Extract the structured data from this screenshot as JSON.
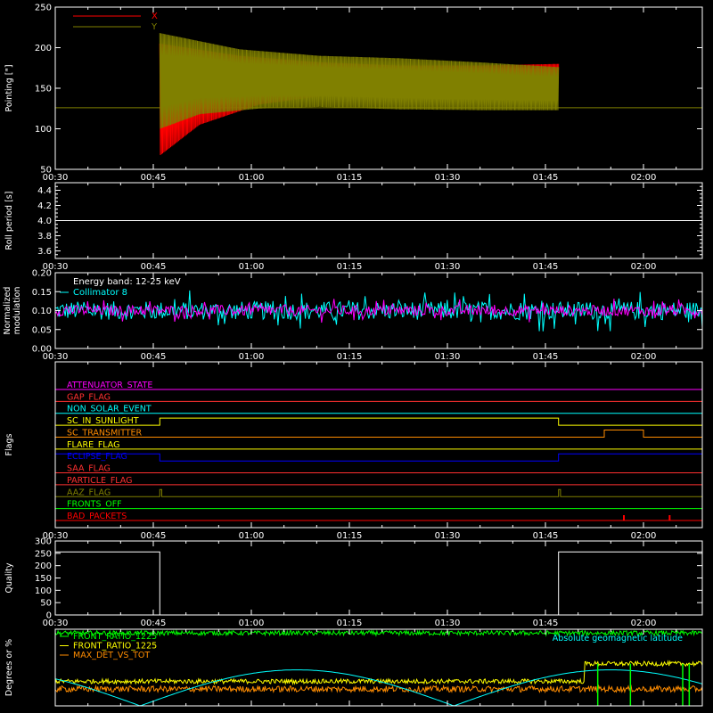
{
  "chart_data": {
    "type": "line",
    "time_ticks": [
      "00:30",
      "00:45",
      "01:00",
      "01:15",
      "01:30",
      "01:45",
      "02:00"
    ],
    "time_range": [
      "00:30",
      "02:09"
    ],
    "data_window": [
      "00:46",
      "01:47"
    ],
    "panels": [
      {
        "id": "pointing",
        "ylabel": "Pointing [\"]",
        "ylim": [
          50,
          250
        ],
        "yticks": [
          "50",
          "100",
          "150",
          "200",
          "250"
        ],
        "xticklabels": true,
        "legend": [
          {
            "name": "X",
            "color": "#ff0000"
          },
          {
            "name": "Y",
            "color": "#808000"
          }
        ],
        "baseline": 126,
        "series": [
          {
            "name": "X",
            "color": "#ff0000",
            "x_start": "00:46",
            "x_end": "01:47",
            "envelope_low": [
              [
                0,
                67
              ],
              [
                0.1,
                105
              ],
              [
                0.25,
                130
              ],
              [
                0.4,
                140
              ],
              [
                0.6,
                145
              ],
              [
                0.8,
                149
              ],
              [
                1.0,
                152
              ]
            ],
            "envelope_high": [
              [
                0,
                205
              ],
              [
                0.2,
                190
              ],
              [
                0.4,
                182
              ],
              [
                0.6,
                178
              ],
              [
                0.8,
                178
              ],
              [
                1.0,
                180
              ]
            ]
          },
          {
            "name": "Y",
            "color": "#808000",
            "x_start": "00:46",
            "x_end": "01:47",
            "envelope_low": [
              [
                0,
                100
              ],
              [
                0.1,
                118
              ],
              [
                0.25,
                125
              ],
              [
                0.4,
                127
              ],
              [
                0.6,
                124
              ],
              [
                0.8,
                123
              ],
              [
                1.0,
                123
              ]
            ],
            "envelope_high": [
              [
                0,
                218
              ],
              [
                0.2,
                198
              ],
              [
                0.4,
                190
              ],
              [
                0.6,
                187
              ],
              [
                0.8,
                182
              ],
              [
                1.0,
                176
              ]
            ]
          }
        ]
      },
      {
        "id": "roll",
        "ylabel": "Roll period [s]",
        "ylim": [
          3.5,
          4.5
        ],
        "yticks": [
          "3.6",
          "3.8",
          "4.0",
          "4.2",
          "4.4"
        ],
        "xticklabels": true,
        "series": [
          {
            "name": "roll period",
            "color": "#ffffff",
            "value": 4.0
          }
        ]
      },
      {
        "id": "modulation",
        "ylabel": [
          "Normalized",
          "modulation"
        ],
        "ylim": [
          0.0,
          0.2
        ],
        "yticks": [
          "0.00",
          "0.05",
          "0.10",
          "0.15",
          "0.20"
        ],
        "xticklabels": true,
        "annotations": [
          {
            "text": "Energy band: 12-25 keV",
            "color": "#ffffff"
          },
          {
            "text": "Collimator 8",
            "color": "#00ffff"
          }
        ],
        "series": [
          {
            "name": "Collimator 8",
            "color": "#00ffff",
            "mean": 0.1,
            "noise": 0.035
          },
          {
            "name": "",
            "color": "#ff00ff",
            "mean": 0.1,
            "noise": 0.02
          }
        ]
      },
      {
        "id": "flags",
        "ylabel": "Flags",
        "xticklabels": true,
        "flags": [
          {
            "name": "ATTENUATOR_STATE",
            "color": "#ff00ff",
            "steps": []
          },
          {
            "name": "GAP_FLAG",
            "color": "#ff3030",
            "steps": []
          },
          {
            "name": "NON_SOLAR_EVENT",
            "color": "#00ffff",
            "steps": []
          },
          {
            "name": "SC_IN_SUNLIGHT",
            "color": "#ffff00",
            "steps": [
              [
                "00:30",
                0
              ],
              [
                "00:46",
                1
              ],
              [
                "01:47",
                0
              ]
            ]
          },
          {
            "name": "SC_TRANSMITTER",
            "color": "#ff8c00",
            "steps": [
              [
                "00:30",
                0
              ],
              [
                "01:54",
                1
              ],
              [
                "02:00",
                0
              ]
            ]
          },
          {
            "name": "FLARE_FLAG",
            "color": "#ffff00",
            "steps": []
          },
          {
            "name": "ECLIPSE_FLAG",
            "color": "#0000ff",
            "steps": [
              [
                "00:30",
                1
              ],
              [
                "00:46",
                0
              ],
              [
                "01:47",
                1
              ]
            ]
          },
          {
            "name": "SAA_FLAG",
            "color": "#ff3030",
            "steps": []
          },
          {
            "name": "PARTICLE_FLAG",
            "color": "#ff3030",
            "steps": []
          },
          {
            "name": "AAZ_FLAG",
            "color": "#808000",
            "steps": [
              [
                "00:30",
                0
              ],
              [
                "00:46",
                1
              ],
              [
                "00:46.3",
                0
              ],
              [
                "01:47",
                1
              ],
              [
                "01:47.3",
                0
              ]
            ]
          },
          {
            "name": "FRONTS_OFF",
            "color": "#00ff00",
            "steps": []
          },
          {
            "name": "BAD_PACKETS",
            "color": "#ff0000",
            "steps": [],
            "spikes": [
              "01:57",
              "02:04"
            ]
          }
        ]
      },
      {
        "id": "quality",
        "ylabel": "Quality",
        "ylim": [
          0,
          300
        ],
        "yticks": [
          "0",
          "50",
          "100",
          "150",
          "200",
          "250",
          "300"
        ],
        "xticklabels": true,
        "series": [
          {
            "name": "quality",
            "color": "#ffffff",
            "steps": [
              [
                "00:30",
                256
              ],
              [
                "00:46",
                0
              ],
              [
                "01:47",
                256
              ]
            ]
          }
        ]
      },
      {
        "id": "ratios",
        "ylabel": "Degrees or %",
        "ylim": [
          0,
          100
        ],
        "xticklabels": false,
        "legend": [
          {
            "name": "FRONT_RATIO_1225",
            "color": "#00ff00"
          },
          {
            "name": "FRONT_RATIO_1225",
            "color": "#ffff00"
          },
          {
            "name": "MAX_DET_VS_TOT",
            "color": "#ff8c00"
          }
        ],
        "annotations": [
          {
            "text": "Absolute geomagnetic latitude",
            "color": "#00ffff"
          }
        ],
        "series": [
          {
            "name": "FRONT_RATIO_1225",
            "color": "#00ff00",
            "mean": 95,
            "noise": 3
          },
          {
            "name": "FRONT_RATIO_1225",
            "color": "#ffff00",
            "mean": 32,
            "noise": 3,
            "step_at": "01:51",
            "step_to": 55
          },
          {
            "name": "MAX_DET_VS_TOT",
            "color": "#ff8c00",
            "mean": 22,
            "noise": 4
          },
          {
            "name": "Absolute geomagnetic latitude",
            "color": "#00ffff",
            "shape": "abs_sine",
            "period_min": 96,
            "amplitude": 47
          }
        ],
        "vlines": {
          "color": "#00ff00",
          "times": [
            "01:53",
            "01:58",
            "02:06",
            "02:07"
          ]
        }
      }
    ]
  }
}
